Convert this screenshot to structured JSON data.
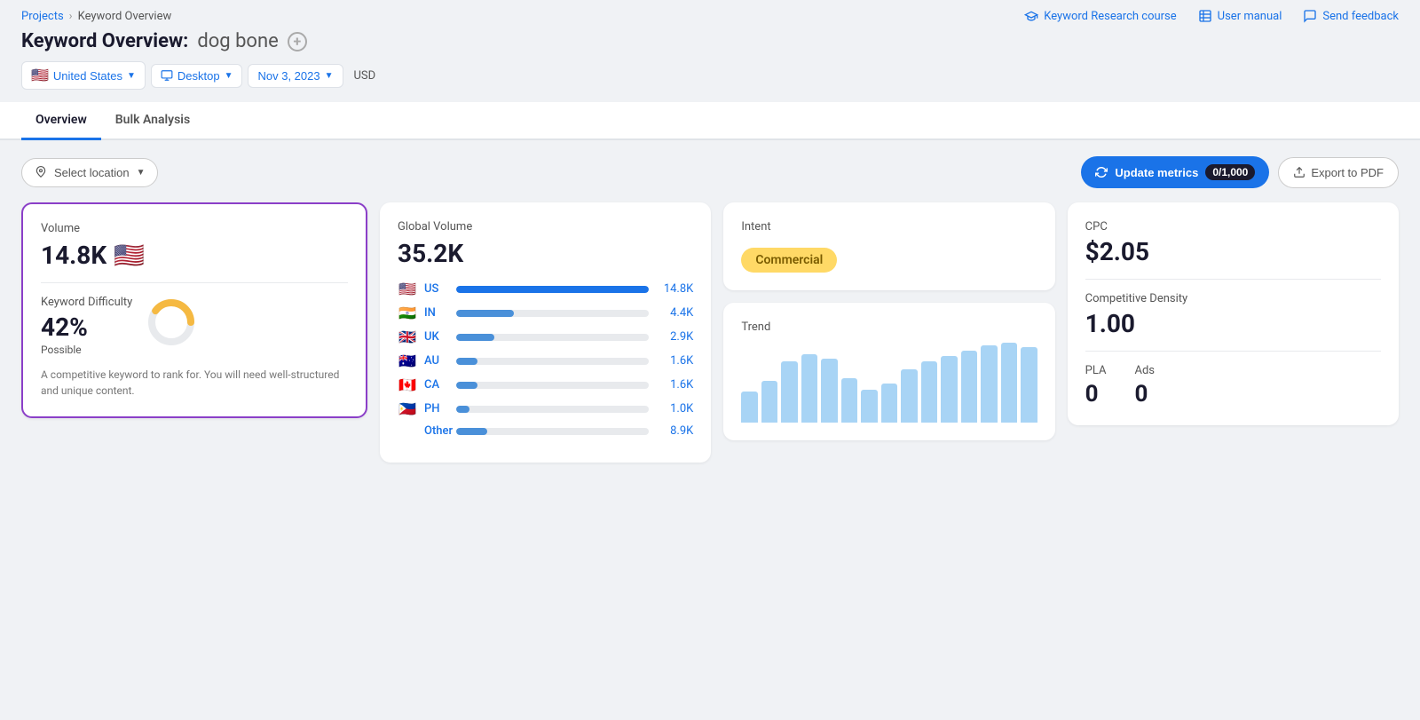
{
  "breadcrumb": {
    "parent": "Projects",
    "separator": "›",
    "current": "Keyword Overview"
  },
  "top_links": [
    {
      "id": "keyword-research-course",
      "label": "Keyword Research course",
      "icon": "graduation-cap"
    },
    {
      "id": "user-manual",
      "label": "User manual",
      "icon": "book"
    },
    {
      "id": "send-feedback",
      "label": "Send feedback",
      "icon": "message"
    }
  ],
  "page_title": {
    "prefix": "Keyword Overview:",
    "keyword": "dog bone",
    "add_icon": "+"
  },
  "filters": {
    "country": {
      "flag": "🇺🇸",
      "label": "United States"
    },
    "device": {
      "label": "Desktop"
    },
    "date": {
      "label": "Nov 3, 2023"
    },
    "currency": "USD"
  },
  "tabs": [
    {
      "id": "overview",
      "label": "Overview",
      "active": true
    },
    {
      "id": "bulk-analysis",
      "label": "Bulk Analysis",
      "active": false
    }
  ],
  "toolbar": {
    "select_location_label": "Select location",
    "update_metrics_label": "Update metrics",
    "update_counter": "0/1,000",
    "export_label": "Export to PDF"
  },
  "cards": {
    "volume": {
      "label": "Volume",
      "value": "14.8K",
      "flag": "🇺🇸"
    },
    "keyword_difficulty": {
      "label": "Keyword Difficulty",
      "value": "42%",
      "sub_label": "Possible",
      "donut_fill": 42,
      "description": "A competitive keyword to rank for. You will need well-structured and unique content."
    },
    "global_volume": {
      "label": "Global Volume",
      "value": "35.2K",
      "countries": [
        {
          "flag": "🇺🇸",
          "code": "US",
          "value": "14.8K",
          "pct": 100
        },
        {
          "flag": "🇮🇳",
          "code": "IN",
          "value": "4.4K",
          "pct": 30
        },
        {
          "flag": "🇬🇧",
          "code": "UK",
          "value": "2.9K",
          "pct": 20
        },
        {
          "flag": "🇦🇺",
          "code": "AU",
          "value": "1.6K",
          "pct": 11
        },
        {
          "flag": "🇨🇦",
          "code": "CA",
          "value": "1.6K",
          "pct": 11
        },
        {
          "flag": "🇵🇭",
          "code": "PH",
          "value": "1.0K",
          "pct": 7
        },
        {
          "flag": "",
          "code": "Other",
          "value": "8.9K",
          "pct": 16
        }
      ]
    },
    "intent": {
      "label": "Intent",
      "badge": "Commercial"
    },
    "trend": {
      "label": "Trend",
      "bars": [
        28,
        38,
        55,
        62,
        58,
        40,
        30,
        35,
        48,
        55,
        60,
        65,
        70,
        72,
        68
      ]
    },
    "cpc": {
      "label": "CPC",
      "value": "$2.05"
    },
    "competitive_density": {
      "label": "Competitive Density",
      "value": "1.00"
    },
    "pla": {
      "label": "PLA",
      "value": "0"
    },
    "ads": {
      "label": "Ads",
      "value": "0"
    }
  }
}
